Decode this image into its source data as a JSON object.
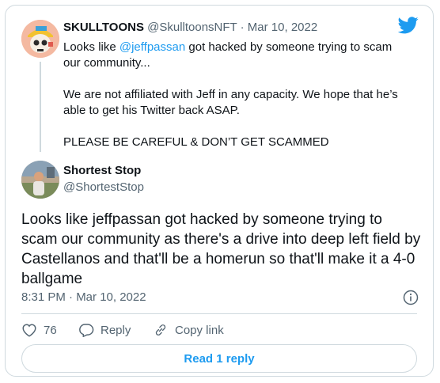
{
  "quoted": {
    "name": "SKULLTOONS",
    "handle": "@SkulltoonsNFT",
    "separator": "·",
    "date": "Mar 10, 2022",
    "text_before_link": "Looks like ",
    "link": "@jeffpassan",
    "text_after_link": " got hacked by someone trying to scam our community...\n\nWe are not affiliated with Jeff in any capacity. We hope that he’s able to get his Twitter back ASAP.\n\nPLEASE BE CAREFUL & DON’T GET SCAMMED"
  },
  "reply": {
    "name": "Shortest Stop",
    "handle": "@ShortestStop",
    "text": "Looks like jeffpassan got hacked by someone trying to scam our community as there's a drive into deep left field by Castellanos and that'll be a homerun so that'll make it a 4-0 ballgame",
    "timestamp": "8:31 PM · Mar 10, 2022"
  },
  "actions": {
    "like_count": "76",
    "reply_label": "Reply",
    "copy_label": "Copy link"
  },
  "read_replies_label": "Read 1 reply",
  "icons": [
    "twitter-bird-icon",
    "info-icon",
    "heart-icon",
    "reply-bubble-icon",
    "link-icon"
  ],
  "colors": {
    "accent": "#1d9bf0",
    "muted": "#536471",
    "border": "#cfd9de"
  }
}
